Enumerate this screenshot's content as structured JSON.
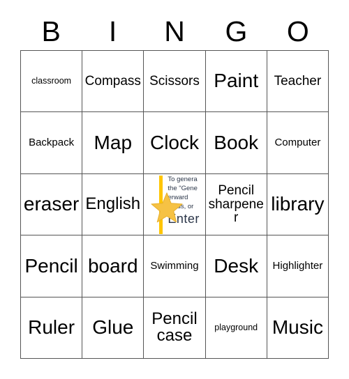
{
  "card": {
    "title": "BINGO",
    "header_letters": [
      "B",
      "I",
      "N",
      "G",
      "O"
    ],
    "colors": {
      "grid_line": "#555555",
      "text": "#000000",
      "background": "#ffffff",
      "star_fill": "#F6C244",
      "star_stroke": "#E8B130",
      "accent_bar": "#FFC500",
      "free_text": "#2a3548"
    },
    "rows": [
      [
        {
          "label": "classroom",
          "size": "fs-xs",
          "free": false
        },
        {
          "label": "Compass",
          "size": "fs-md",
          "free": false
        },
        {
          "label": "Scissors",
          "size": "fs-md",
          "free": false
        },
        {
          "label": "Paint",
          "size": "fs-xl",
          "free": false
        },
        {
          "label": "Teacher",
          "size": "fs-md",
          "free": false
        }
      ],
      [
        {
          "label": "Backpack",
          "size": "fs-sm",
          "free": false
        },
        {
          "label": "Map",
          "size": "fs-xl",
          "free": false
        },
        {
          "label": "Clock",
          "size": "fs-xl",
          "free": false
        },
        {
          "label": "Book",
          "size": "fs-xl",
          "free": false
        },
        {
          "label": "Computer",
          "size": "fs-sm",
          "free": false
        }
      ],
      [
        {
          "label": "eraser",
          "size": "fs-xl",
          "free": false
        },
        {
          "label": "English",
          "size": "fs-lg",
          "free": false
        },
        {
          "label": "",
          "size": "fs-xs",
          "free": true
        },
        {
          "label": "Pencil sharpener",
          "size": "fs-md",
          "free": false
        },
        {
          "label": "library",
          "size": "fs-xl",
          "free": false
        }
      ],
      [
        {
          "label": "Pencil",
          "size": "fs-xl",
          "free": false
        },
        {
          "label": "board",
          "size": "fs-xl",
          "free": false
        },
        {
          "label": "Swimming",
          "size": "fs-sm",
          "free": false
        },
        {
          "label": "Desk",
          "size": "fs-xl",
          "free": false
        },
        {
          "label": "Highlighter",
          "size": "fs-sm",
          "free": false
        }
      ],
      [
        {
          "label": "Ruler",
          "size": "fs-xl",
          "free": false
        },
        {
          "label": "Glue",
          "size": "fs-xl",
          "free": false
        },
        {
          "label": "Pencil case",
          "size": "fs-lg",
          "free": false
        },
        {
          "label": "playground",
          "size": "fs-xs",
          "free": false
        },
        {
          "label": "Music",
          "size": "fs-xl",
          "free": false
        }
      ]
    ],
    "free_space": {
      "icon": "star-icon",
      "overflow_text_lines": [
        "To genera",
        "the \"Gene",
        "erward",
        "cards, or"
      ],
      "clipped_line": "Enter"
    }
  }
}
